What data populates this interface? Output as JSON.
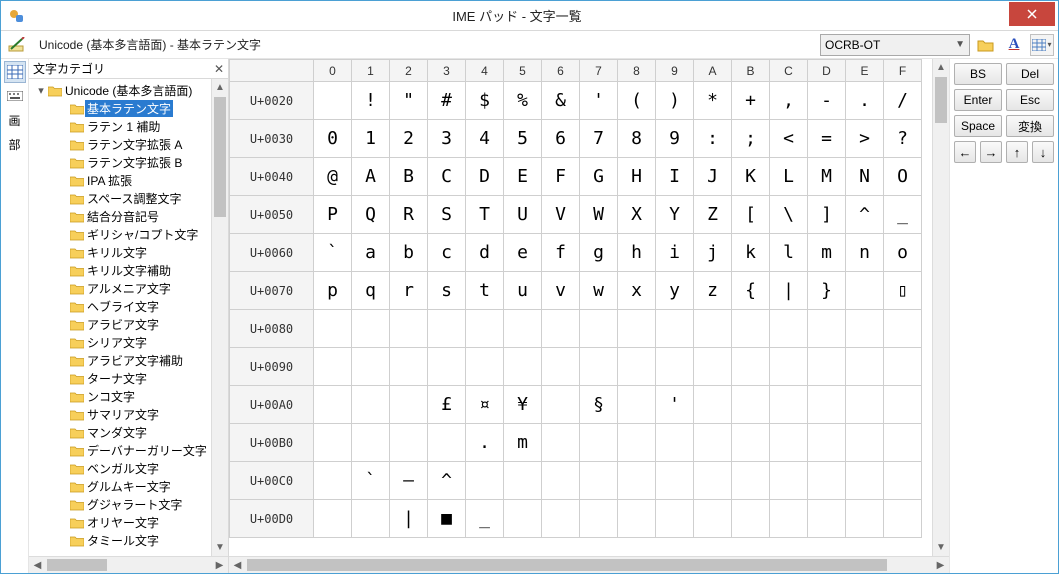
{
  "title": "IME パッド - 文字一覧",
  "path_label": "Unicode (基本多言語面) - 基本ラテン文字",
  "font_selected": "OCRB-OT",
  "tree_header": "文字カテゴリ",
  "tree_root": "Unicode (基本多言語面)",
  "tree_items": [
    "基本ラテン文字",
    "ラテン 1 補助",
    "ラテン文字拡張 A",
    "ラテン文字拡張 B",
    "IPA 拡張",
    "スペース調整文字",
    "結合分音記号",
    "ギリシャ/コプト文字",
    "キリル文字",
    "キリル文字補助",
    "アルメニア文字",
    "ヘブライ文字",
    "アラビア文字",
    "シリア文字",
    "アラビア文字補助",
    "ターナ文字",
    "ンコ文字",
    "サマリア文字",
    "マンダ文字",
    "デーバナーガリー文字",
    "ベンガル文字",
    "グルムキー文字",
    "グジャラート文字",
    "オリヤー文字",
    "タミール文字"
  ],
  "tree_selected_index": 0,
  "col_headers": [
    "0",
    "1",
    "2",
    "3",
    "4",
    "5",
    "6",
    "7",
    "8",
    "9",
    "A",
    "B",
    "C",
    "D",
    "E",
    "F"
  ],
  "rows": [
    {
      "h": "U+0020",
      "c": [
        "",
        "!",
        "\"",
        "#",
        "$",
        "%",
        "&",
        "'",
        "(",
        ")",
        "*",
        "+",
        ",",
        "-",
        ".",
        "/"
      ]
    },
    {
      "h": "U+0030",
      "c": [
        "0",
        "1",
        "2",
        "3",
        "4",
        "5",
        "6",
        "7",
        "8",
        "9",
        ":",
        ";",
        "<",
        "=",
        ">",
        "?"
      ]
    },
    {
      "h": "U+0040",
      "c": [
        "@",
        "A",
        "B",
        "C",
        "D",
        "E",
        "F",
        "G",
        "H",
        "I",
        "J",
        "K",
        "L",
        "M",
        "N",
        "O"
      ]
    },
    {
      "h": "U+0050",
      "c": [
        "P",
        "Q",
        "R",
        "S",
        "T",
        "U",
        "V",
        "W",
        "X",
        "Y",
        "Z",
        "[",
        "\\",
        "]",
        "^",
        "_"
      ]
    },
    {
      "h": "U+0060",
      "c": [
        "`",
        "a",
        "b",
        "c",
        "d",
        "e",
        "f",
        "g",
        "h",
        "i",
        "j",
        "k",
        "l",
        "m",
        "n",
        "o"
      ]
    },
    {
      "h": "U+0070",
      "c": [
        "p",
        "q",
        "r",
        "s",
        "t",
        "u",
        "v",
        "w",
        "x",
        "y",
        "z",
        "{",
        "|",
        "}",
        " ",
        "▯"
      ]
    },
    {
      "h": "U+0080",
      "c": [
        "",
        "",
        "",
        "",
        "",
        "",
        "",
        "",
        "",
        "",
        "",
        "",
        "",
        "",
        "",
        ""
      ]
    },
    {
      "h": "U+0090",
      "c": [
        "",
        "",
        "",
        "",
        "",
        "",
        "",
        "",
        "",
        "",
        "",
        "",
        "",
        "",
        "",
        ""
      ]
    },
    {
      "h": "U+00A0",
      "c": [
        "",
        "",
        "",
        "£",
        "¤",
        "¥",
        "",
        "§",
        "",
        "'",
        "",
        "",
        "",
        "",
        "",
        ""
      ]
    },
    {
      "h": "U+00B0",
      "c": [
        "",
        "",
        "",
        "",
        ".",
        "m",
        "",
        "",
        "",
        "",
        "",
        "",
        "",
        "",
        "",
        ""
      ]
    },
    {
      "h": "U+00C0",
      "c": [
        "",
        "`",
        "—",
        "^",
        "",
        "",
        "",
        "",
        "",
        "",
        "",
        "",
        "",
        "",
        "",
        ""
      ]
    },
    {
      "h": "U+00D0",
      "c": [
        "",
        "",
        "|",
        "■",
        "_",
        "",
        "",
        "",
        "",
        "",
        "",
        "",
        "",
        "",
        "",
        ""
      ]
    }
  ],
  "buttons": {
    "bs": "BS",
    "del": "Del",
    "enter": "Enter",
    "esc": "Esc",
    "space": "Space",
    "conv": "変換",
    "left": "←",
    "right": "→",
    "up": "↑",
    "down": "↓"
  }
}
